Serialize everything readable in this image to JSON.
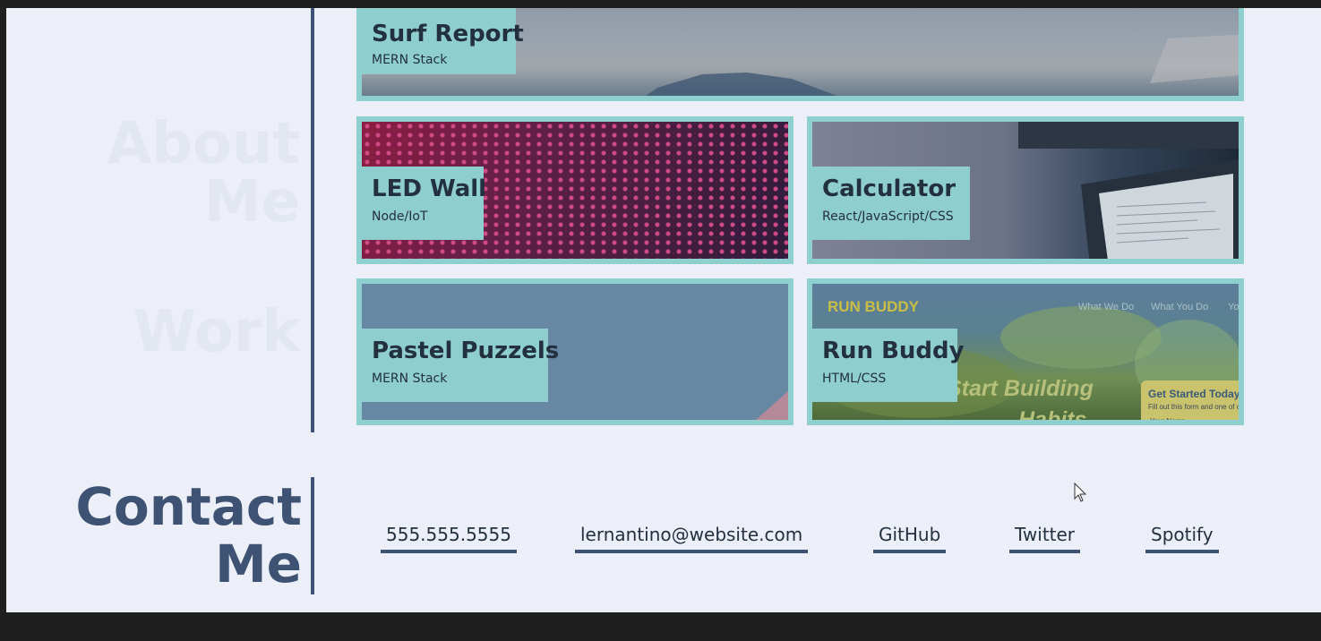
{
  "projects": [
    {
      "title": "Surf Report",
      "stack": "MERN Stack",
      "image": "ocean-wave-photo"
    },
    {
      "title": "LED Wall",
      "stack": "Node/IoT",
      "image": "led-matrix-photo"
    },
    {
      "title": "Calculator",
      "stack": "React/JavaScript/CSS",
      "image": "laptop-code-photo"
    },
    {
      "title": "Pastel Puzzels",
      "stack": "MERN Stack",
      "image": "pastel-shapes-image"
    },
    {
      "title": "Run Buddy",
      "stack": "HTML/CSS",
      "image": "run-buddy-site-screenshot"
    }
  ],
  "run_buddy_preview": {
    "brand": "RUN BUDDY",
    "nav": [
      "What We Do",
      "What You Do",
      "Yo"
    ],
    "hero": "Start Building",
    "hero2": "Habits",
    "signup_title": "Get Started Today",
    "signup_text": "Fill out this form and one of c",
    "signup_field": "Your Name"
  },
  "contact": {
    "title_line1": "Contact",
    "title_line2": "Me",
    "links": [
      "555.555.5555",
      "lernantino@website.com",
      "GitHub",
      "Twitter",
      "Spotify"
    ]
  },
  "colors": {
    "accent": "#8ecfcf",
    "primary": "#3e5273",
    "background": "#eceff7",
    "frame": "#1f1f1f"
  }
}
